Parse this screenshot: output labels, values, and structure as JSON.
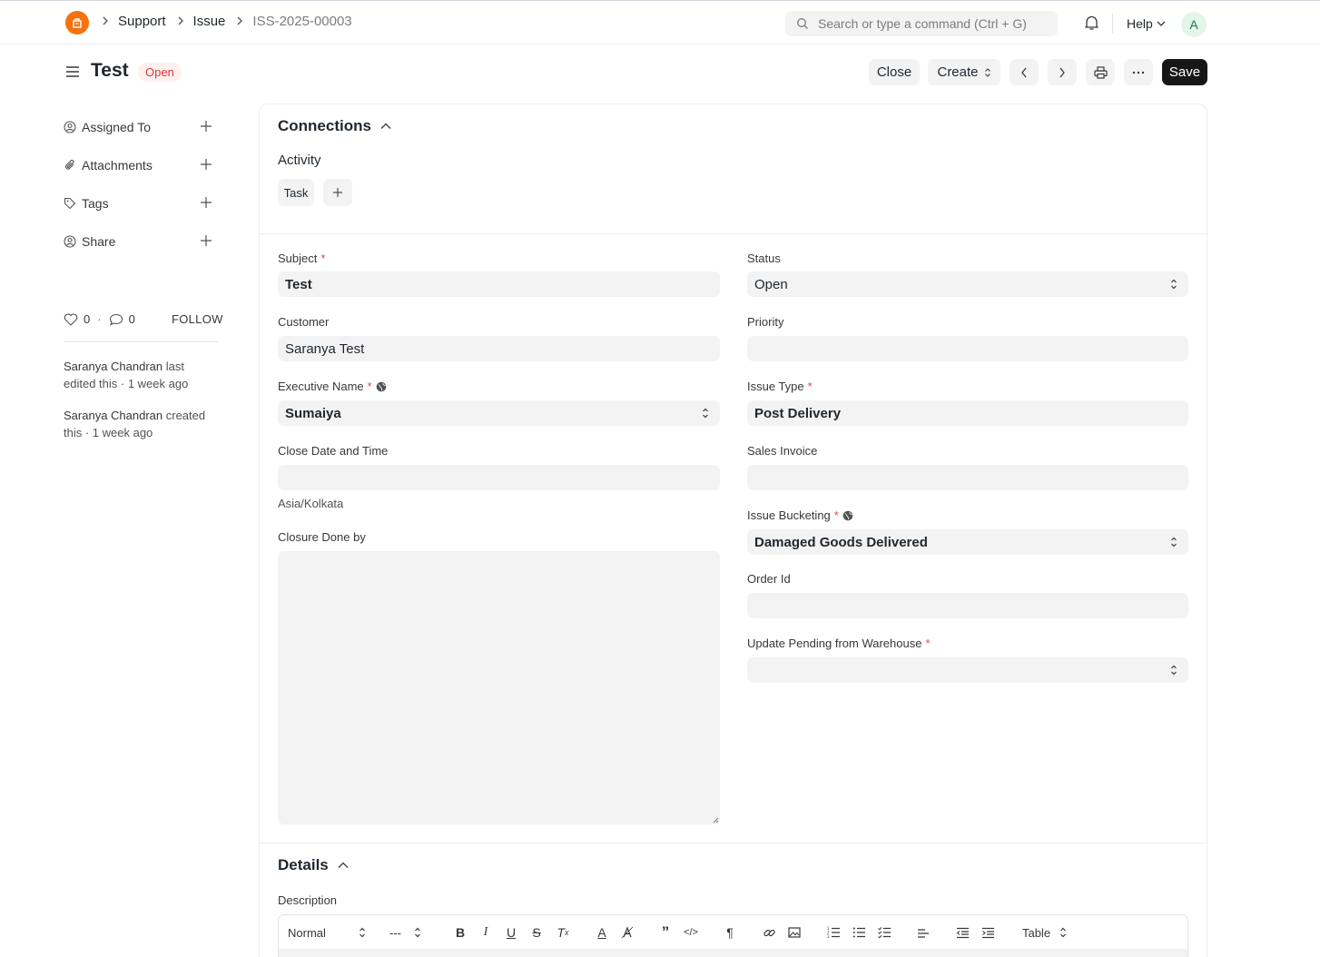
{
  "navbar": {
    "breadcrumbs": [
      "Support",
      "Issue",
      "ISS-2025-00003"
    ],
    "search_placeholder": "Search or type a command (Ctrl + G)",
    "help_label": "Help",
    "avatar_initial": "A",
    "accent_color": "#f5720d"
  },
  "page": {
    "title": "Test",
    "status": "Open",
    "actions": {
      "close": "Close",
      "create": "Create",
      "save": "Save"
    }
  },
  "sidebar": {
    "items": [
      {
        "label": "Assigned To",
        "icon": "assign-icon"
      },
      {
        "label": "Attachments",
        "icon": "paperclip-icon"
      },
      {
        "label": "Tags",
        "icon": "tag-icon"
      },
      {
        "label": "Share",
        "icon": "share-icon"
      }
    ],
    "likes": "0",
    "comments": "0",
    "follow_label": "FOLLOW",
    "activity": [
      {
        "who": "Saranya Chandran",
        "what": " last edited this · 1 week ago"
      },
      {
        "who": "Saranya Chandran",
        "what": " created this · 1 week ago"
      }
    ]
  },
  "connections": {
    "title": "Connections",
    "activity_label": "Activity",
    "chips": [
      "Task"
    ]
  },
  "form": {
    "subject": {
      "label": "Subject",
      "value": "Test"
    },
    "status": {
      "label": "Status",
      "value": "Open"
    },
    "customer": {
      "label": "Customer",
      "value": "Saranya Test"
    },
    "priority": {
      "label": "Priority",
      "value": ""
    },
    "executive_name": {
      "label": "Executive Name",
      "value": "Sumaiya"
    },
    "issue_type": {
      "label": "Issue Type",
      "value": "Post Delivery"
    },
    "close_date": {
      "label": "Close Date and Time",
      "value": "",
      "timezone": "Asia/Kolkata"
    },
    "sales_invoice": {
      "label": "Sales Invoice",
      "value": ""
    },
    "issue_bucketing": {
      "label": "Issue Bucketing",
      "value": "Damaged Goods Delivered"
    },
    "closure_done_by": {
      "label": "Closure Done by",
      "value": ""
    },
    "order_id": {
      "label": "Order Id",
      "value": ""
    },
    "update_pending": {
      "label": "Update Pending from Warehouse",
      "value": ""
    }
  },
  "details": {
    "title": "Details",
    "description_label": "Description",
    "toolbar": {
      "font_style": "Normal",
      "font_size": "---",
      "table": "Table"
    }
  }
}
